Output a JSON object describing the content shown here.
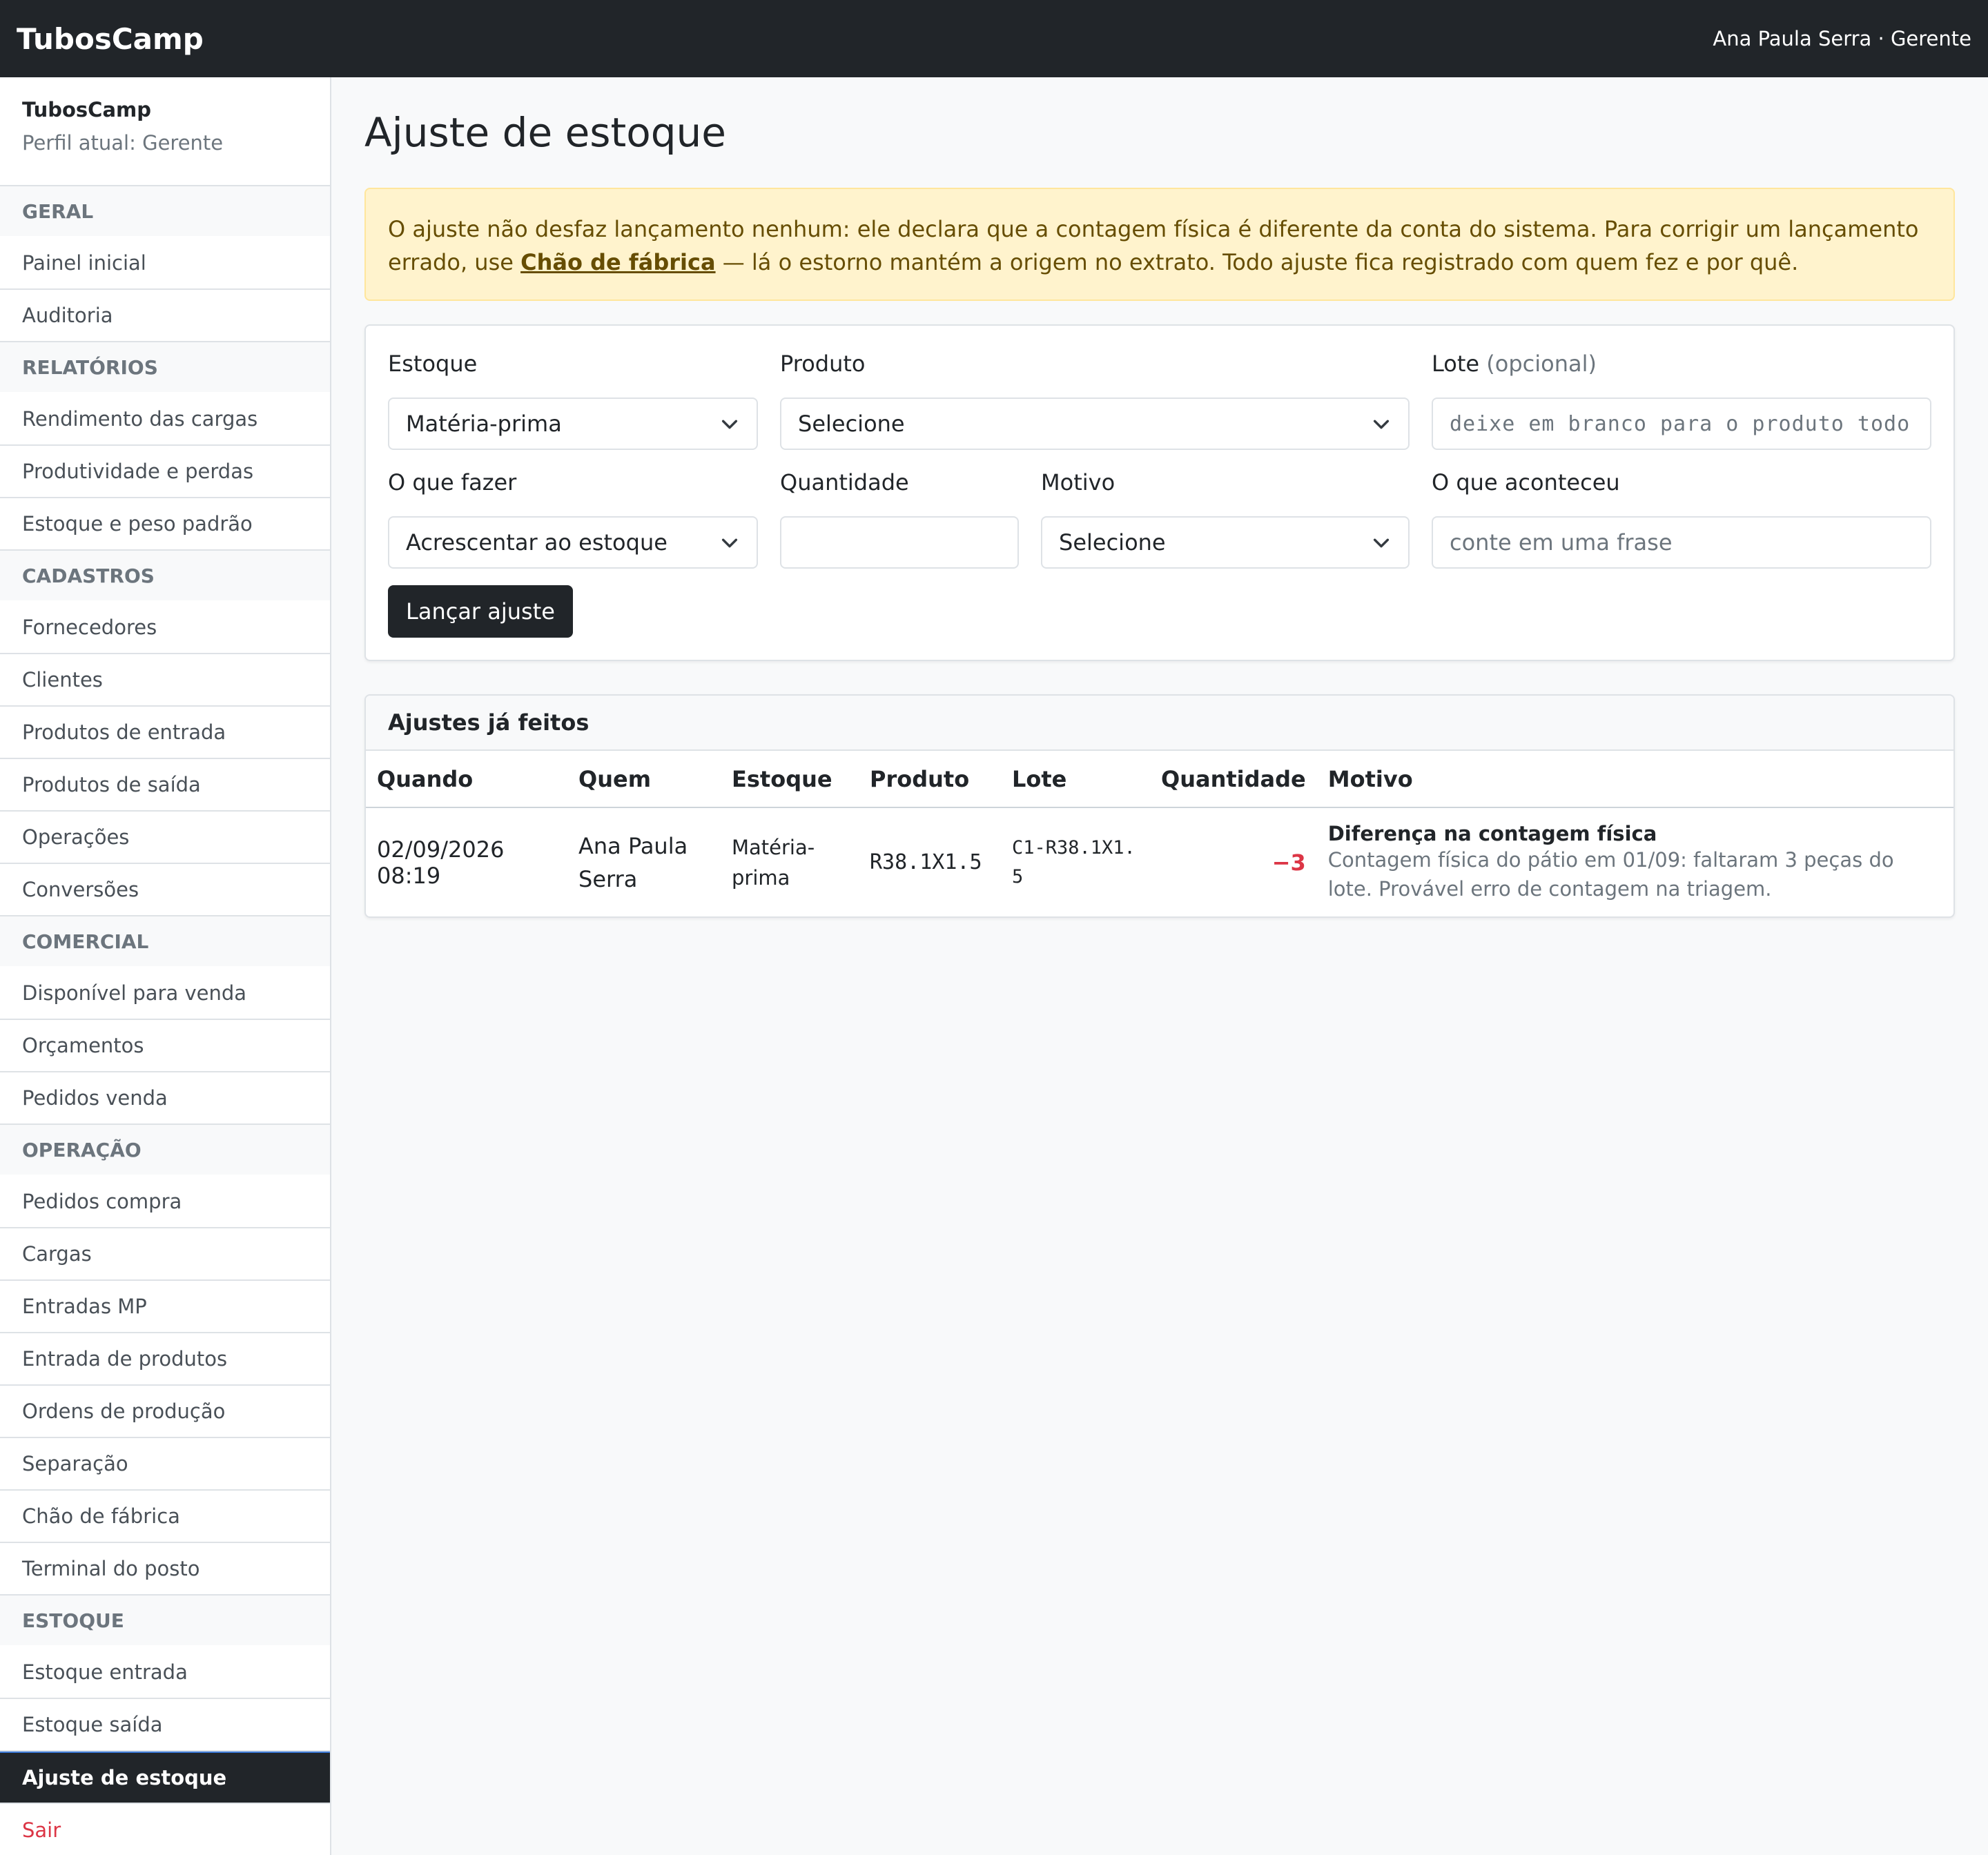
{
  "topbar": {
    "brand": "TubosCamp",
    "user": "Ana Paula Serra · Gerente"
  },
  "sidebar": {
    "name": "TubosCamp",
    "profile": "Perfil atual: Gerente",
    "sections": {
      "geral": "GERAL",
      "relatorios": "RELATÓRIOS",
      "cadastros": "CADASTROS",
      "comercial": "COMERCIAL",
      "operacao": "OPERAÇÃO",
      "estoque": "ESTOQUE"
    },
    "items": {
      "painel": "Painel inicial",
      "auditoria": "Auditoria",
      "rendimento": "Rendimento das cargas",
      "produtividade": "Produtividade e perdas",
      "estoque_peso": "Estoque e peso padrão",
      "fornecedores": "Fornecedores",
      "clientes": "Clientes",
      "produtos_entrada": "Produtos de entrada",
      "produtos_saida": "Produtos de saída",
      "operacoes": "Operações",
      "conversoes": "Conversões",
      "disponivel": "Disponível para venda",
      "orcamentos": "Orçamentos",
      "pedidos_venda": "Pedidos venda",
      "pedidos_compra": "Pedidos compra",
      "cargas": "Cargas",
      "entradas_mp": "Entradas MP",
      "entrada_produtos": "Entrada de produtos",
      "ordens_producao": "Ordens de produção",
      "separacao": "Separação",
      "chao_fabrica": "Chão de fábrica",
      "terminal": "Terminal do posto",
      "estoque_entrada": "Estoque entrada",
      "estoque_saida": "Estoque saída",
      "ajuste": "Ajuste de estoque",
      "sair": "Sair"
    }
  },
  "page": {
    "title": "Ajuste de estoque"
  },
  "alert": {
    "text_before": "O ajuste não desfaz lançamento nenhum: ele declara que a contagem física é diferente da conta do sistema. Para corrigir um lançamento errado, use ",
    "link": "Chão de fábrica",
    "text_after": " — lá o estorno mantém a origem no extrato. Todo ajuste fica registrado com quem fez e por quê."
  },
  "form": {
    "estoque": {
      "label": "Estoque",
      "value": "Matéria-prima"
    },
    "produto": {
      "label": "Produto",
      "value": "Selecione"
    },
    "lote": {
      "label": "Lote",
      "label_opt": "(opcional)",
      "placeholder": "deixe em branco para o produto todo"
    },
    "acao": {
      "label": "O que fazer",
      "value": "Acrescentar ao estoque"
    },
    "quantidade": {
      "label": "Quantidade",
      "value": ""
    },
    "motivo": {
      "label": "Motivo",
      "value": "Selecione"
    },
    "aconteceu": {
      "label": "O que aconteceu",
      "placeholder": "conte em uma frase"
    },
    "submit": "Lançar ajuste"
  },
  "history": {
    "title": "Ajustes já feitos",
    "columns": [
      "Quando",
      "Quem",
      "Estoque",
      "Produto",
      "Lote",
      "Quantidade",
      "Motivo"
    ],
    "rows": [
      {
        "quando": "02/09/2026 08:19",
        "quem": "Ana Paula Serra",
        "estoque": "Matéria-prima",
        "produto": "R38.1X1.5",
        "lote": "C1-R38.1X1.5",
        "quantidade": "−3",
        "motivo_titulo": "Diferença na contagem física",
        "motivo_texto": "Contagem física do pátio em 01/09: faltaram 3 peças do lote. Provável erro de contagem na triagem."
      }
    ]
  }
}
